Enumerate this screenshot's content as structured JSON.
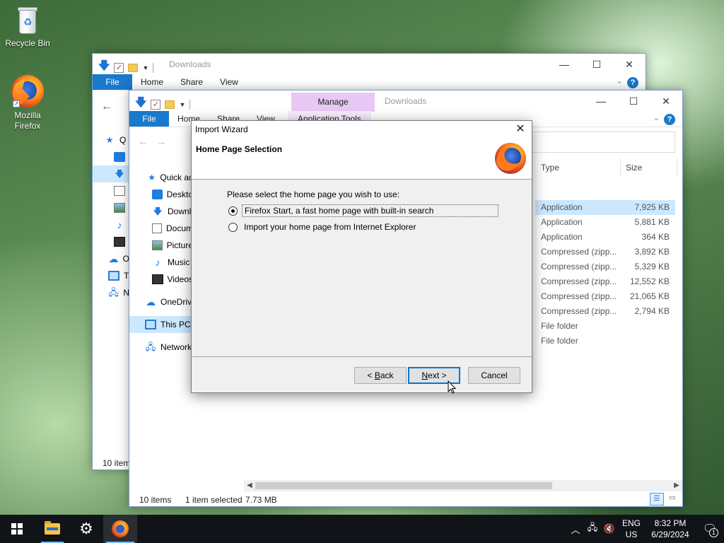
{
  "desktop": {
    "recycle_bin": "Recycle Bin",
    "firefox": "Mozilla Firefox"
  },
  "explorer_back": {
    "title": "Downloads",
    "tabs": [
      "File",
      "Home",
      "Share",
      "View"
    ],
    "nav_items": [
      "Q",
      "",
      "",
      "",
      "",
      "",
      "",
      "O",
      "T",
      "N"
    ],
    "status": "10 item"
  },
  "explorer_front": {
    "title": "Downloads",
    "manage_tab": "Manage",
    "app_tools_tab": "Application Tools",
    "tabs": [
      "File",
      "Home",
      "Share",
      "View"
    ],
    "nav_items": [
      {
        "label": "Quick ac",
        "icon": "star-icon"
      },
      {
        "label": "Deskto",
        "icon": "desktop-icon"
      },
      {
        "label": "Downl",
        "icon": "downloads-icon"
      },
      {
        "label": "Docum",
        "icon": "documents-icon"
      },
      {
        "label": "Picture",
        "icon": "pictures-icon"
      },
      {
        "label": "Music",
        "icon": "music-icon"
      },
      {
        "label": "Videos",
        "icon": "videos-icon"
      },
      {
        "label": "OneDriv",
        "icon": "onedrive-icon"
      },
      {
        "label": "This PC",
        "icon": "this-pc-icon"
      },
      {
        "label": "Network",
        "icon": "network-icon"
      }
    ],
    "columns": {
      "type": "Type",
      "size": "Size"
    },
    "rows": [
      {
        "type": "Application",
        "size": "7,925 KB"
      },
      {
        "type": "Application",
        "size": "5,881 KB"
      },
      {
        "type": "Application",
        "size": "364 KB"
      },
      {
        "type": "Compressed (zipp...",
        "size": "3,892 KB"
      },
      {
        "type": "Compressed (zipp...",
        "size": "5,329 KB"
      },
      {
        "type": "Compressed (zipp...",
        "size": "12,552 KB"
      },
      {
        "type": "Compressed (zipp...",
        "size": "21,065 KB"
      },
      {
        "type": "Compressed (zipp...",
        "size": "2,794 KB"
      },
      {
        "type": "File folder",
        "size": ""
      },
      {
        "type": "File folder",
        "size": ""
      }
    ],
    "status_items": "10 items",
    "status_selected": "1 item selected",
    "status_size": "7.73 MB"
  },
  "dialog": {
    "title": "Import Wizard",
    "heading": "Home Page Selection",
    "prompt": "Please select the home page you wish to use:",
    "options": [
      {
        "label": "Firefox Start, a fast home page with built-in search",
        "selected": true
      },
      {
        "label": "Import your home page from Internet Explorer",
        "selected": false
      }
    ],
    "back_label_prefix": "< ",
    "back_label_key": "B",
    "back_label_rest": "ack",
    "next_label_key": "N",
    "next_label_rest": "ext >",
    "cancel_label": "Cancel"
  },
  "taskbar": {
    "lang_top": "ENG",
    "lang_bottom": "US",
    "time": "8:32 PM",
    "date": "6/29/2024",
    "notification_count": "1"
  }
}
